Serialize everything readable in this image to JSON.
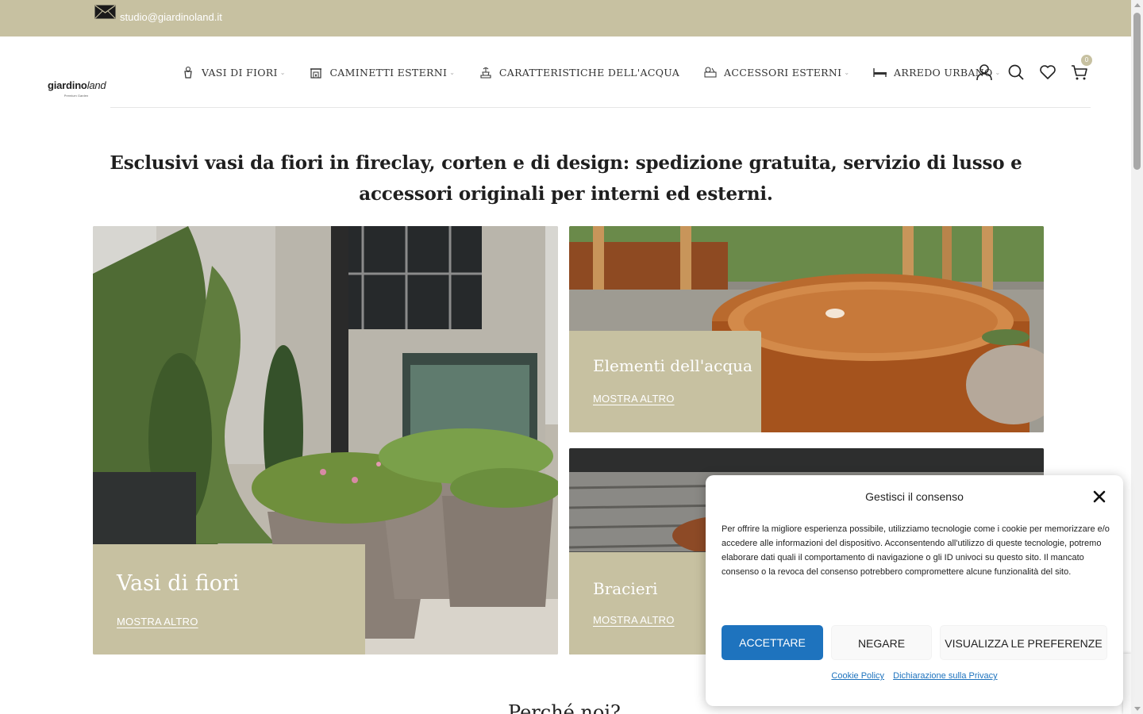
{
  "topbar": {
    "email": "studio@giardinoland.it",
    "mail_icon": "envelope-icon"
  },
  "logo": {
    "word_bold": "giardino",
    "word_italic": "land",
    "tagline": "Premium Garden"
  },
  "nav": [
    {
      "label": "VASI DI FIORI",
      "icon": "flower-pot-icon",
      "has_dropdown": true
    },
    {
      "label": "CAMINETTI ESTERNI",
      "icon": "fireplace-icon",
      "has_dropdown": true
    },
    {
      "label": "CARATTERISTICHE DELL'ACQUA",
      "icon": "fountain-icon",
      "has_dropdown": false
    },
    {
      "label": "ACCESSORI ESTERNI",
      "icon": "garden-accessory-icon",
      "has_dropdown": true
    },
    {
      "label": "ARREDO URBANO",
      "icon": "bench-icon",
      "has_dropdown": true
    }
  ],
  "header_icons": {
    "account": "user-icon",
    "search": "search-icon",
    "wishlist": "heart-icon",
    "cart": "cart-icon",
    "cart_count": "0"
  },
  "tagline": "Esclusivi vasi da fiori in fireclay, corten e di design: spedizione gratuita, servizio di lusso e accessori originali per interni ed esterni.",
  "cards": {
    "big": {
      "title": "Vasi di fiori",
      "link": "MOSTRA ALTRO"
    },
    "top_right": {
      "title": "Elementi dell'acqua",
      "link": "MOSTRA ALTRO"
    },
    "bottom_right": {
      "title": "Bracieri",
      "link": "MOSTRA ALTRO"
    }
  },
  "next_heading": "Perché noi?",
  "cookie": {
    "title": "Gestisci il consenso",
    "text": "Per offrire la migliore esperienza possibile, utilizziamo tecnologie come i cookie per memorizzare e/o accedere alle informazioni del dispositivo. Acconsentendo all'utilizzo di queste tecnologie, potremo elaborare dati quali il comportamento di navigazione o gli ID univoci su questo sito. Il mancato consenso o la revoca del consenso potrebbero compromettere alcune funzionalità del sito.",
    "accept": "ACCETTARE",
    "deny": "NEGARE",
    "preferences": "VISUALIZZA LE PREFERENZE",
    "cookie_policy": "Cookie Policy",
    "privacy": "Dichiarazione sulla Privacy"
  },
  "colors": {
    "accent": "#c7c1a1",
    "button_blue": "#1e73be"
  }
}
